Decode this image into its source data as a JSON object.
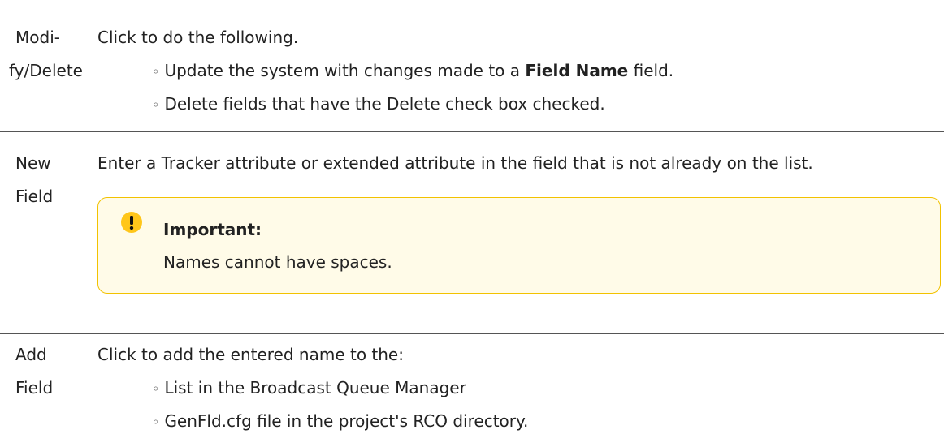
{
  "rows": [
    {
      "term_line1": "Modi-",
      "term_line2": "fy/Delete",
      "intro": "Click to do the following.",
      "bullet1_pre": "Update the system with changes made to a ",
      "bullet1_bold": "Field Name",
      "bullet1_post": " field.",
      "bullet2": "Delete fields that have the Delete check box checked."
    },
    {
      "term_line1": "New",
      "term_line2": "Field",
      "description": "Enter a Tracker attribute or extended attribute in the field that is not already on the list.",
      "note": {
        "icon": "exclamation-icon",
        "title": "Important:",
        "body": "Names cannot have spaces."
      }
    },
    {
      "term_line1": "Add",
      "term_line2": "Field",
      "intro": "Click to add the entered name to the:",
      "bullet1": "List in the Broadcast Queue Manager",
      "bullet2": "GenFld.cfg file in the project's RCO directory."
    }
  ],
  "colors": {
    "note_border": "#f2c200",
    "note_background": "#fffbe8",
    "note_icon": "#ffc61a",
    "grid_line": "#555555"
  }
}
